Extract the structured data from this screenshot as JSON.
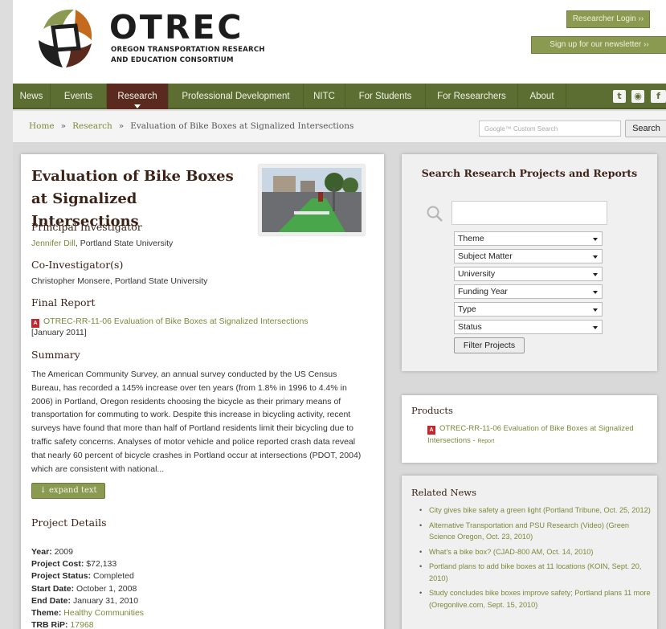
{
  "header": {
    "brand": "OTREC",
    "subtitle_line1": "OREGON TRANSPORTATION RESEARCH",
    "subtitle_line2": "AND EDUCATION CONSORTIUM",
    "login_button": "Researcher Login ››",
    "newsletter_button": "Sign up for our newsletter ››"
  },
  "nav": {
    "items": [
      "News",
      "Events",
      "Research",
      "Professional Development",
      "NITC",
      "For Students",
      "For Researchers",
      "About"
    ],
    "active": "Research",
    "social": [
      "t",
      "rss",
      "f"
    ]
  },
  "breadcrumb": {
    "home": "Home",
    "section": "Research",
    "current": "Evaluation of Bike Boxes at Signalized Intersections",
    "separator": "»"
  },
  "site_search": {
    "placeholder": "Google™ Custom Search",
    "button": "Search"
  },
  "project": {
    "title": "Evaluation of Bike Boxes at Signalized Intersections",
    "pi_heading": "Principal Investigator",
    "pi_name": "Jennifer Dill",
    "pi_affiliation": ", Portland State University",
    "coi_heading": "Co-Investigator(s)",
    "coi": "Christopher Monsere, Portland State University",
    "report_heading": "Final Report",
    "report_link": "OTREC-RR-11-06 Evaluation of Bike Boxes at Signalized Intersections",
    "report_date": "[January 2011]",
    "summary_heading": "Summary",
    "summary": "The American Community Survey, an annual survey conducted by the US Census Bureau, has recorded a 145% increase over ten years (from 1.8% in 1996 to 4.4% in 2006) in Portland, Oregon residents choosing the bicycle as their primary means of transportation for commuting to work. Despite this increase in bicycling activity, recent surveys have found that more than half of Portland residents limit their bicycling due to traffic safety concerns. Analyses of motor vehicle and police reported crash data reveal that nearly 60 percent of bicycle crashes in Portland occur at intersections (PDOT, 2004) which are consistent with national...",
    "expand_label": "↓ expand text",
    "details_heading": "Project Details",
    "details": {
      "year_label": "Year:",
      "year": "2009",
      "cost_label": "Project Cost:",
      "cost": "$72,133",
      "status_label": "Project Status:",
      "status": "Completed",
      "start_label": "Start Date:",
      "start": "October 1, 2008",
      "end_label": "End Date:",
      "end": "January 31, 2010",
      "theme_label": "Theme:",
      "theme": "Healthy Communities",
      "trb_label": "TRB RiP:",
      "trb": "17968"
    }
  },
  "research_search": {
    "title": "Search Research Projects and Reports",
    "selects": [
      "Theme",
      "Subject Matter",
      "University",
      "Funding Year",
      "Type",
      "Status"
    ],
    "filter_button": "Filter Projects"
  },
  "products": {
    "heading": "Products",
    "item": "OTREC-RR-11-06 Evaluation of Bike Boxes at Signalized Intersections",
    "item_suffix": " - ",
    "item_type": "Report"
  },
  "related_news": {
    "heading": "Related News",
    "items": [
      "City gives bike safety a green light (Portland Tribune, Oct. 25, 2012)",
      "Alternative Transportation and PSU Research (Video) (Green Science Oregon, Oct. 23, 2010)",
      "What's a bike box? (CJAD-800 AM, Oct. 14, 2010)",
      "Portland plans to add bike boxes at 11 locations (KOIN, Sept. 20, 2010)",
      "Study concludes bike boxes improve safety; Portland plans 11 more (Oregonlive.com, Sept. 15, 2010)"
    ]
  },
  "colors": {
    "nav_green": "#5d6e32",
    "active_brown": "#5b2a1e",
    "link_green": "#7a8a3a",
    "heading_brown": "#3d2317",
    "button_green": "#8a9a50"
  }
}
